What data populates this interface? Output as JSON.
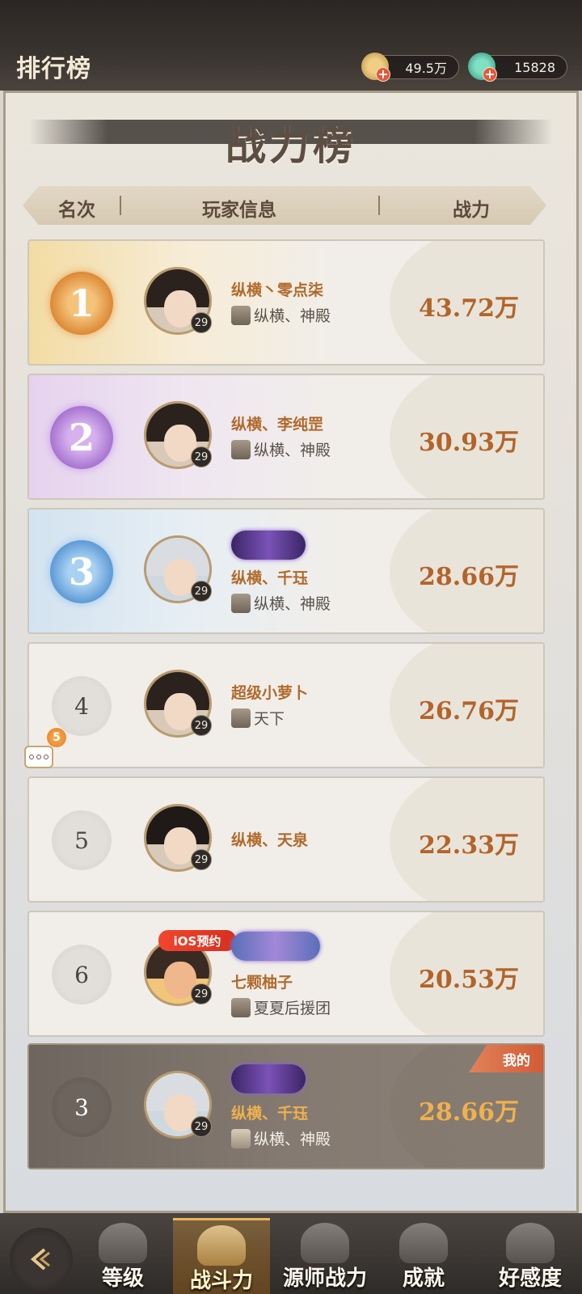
{
  "header": {
    "title": "排行榜",
    "coins": "49.5万",
    "gems": "15828"
  },
  "board": {
    "title": "战力榜",
    "col_rank": "名次",
    "col_player": "玩家信息",
    "col_power": "战力"
  },
  "rows": [
    {
      "rank": "1",
      "name": "纵横丶零点柒",
      "guild": "纵横、神殿",
      "power": "43.72万",
      "level": "29"
    },
    {
      "rank": "2",
      "name": "纵横、李纯罡",
      "guild": "纵横、神殿",
      "power": "30.93万",
      "level": "29"
    },
    {
      "rank": "3",
      "name": "纵横、千珏",
      "guild": "纵横、神殿",
      "power": "28.66万",
      "level": "29"
    },
    {
      "rank": "4",
      "name": "超级小萝卜",
      "guild": "天下",
      "power": "26.76万",
      "level": "29"
    },
    {
      "rank": "5",
      "name": "纵横、天泉",
      "guild": "",
      "power": "22.33万",
      "level": "29"
    },
    {
      "rank": "6",
      "name": "七颗柚子",
      "guild": "夏夏后援团",
      "power": "20.53万",
      "level": "29",
      "tag": "iOS预约"
    }
  ],
  "mine": {
    "label": "我的",
    "rank": "3",
    "name": "纵横、千珏",
    "guild": "纵横、神殿",
    "power": "28.66万",
    "level": "29"
  },
  "chat": {
    "count": "5"
  },
  "nav": {
    "tabs": [
      {
        "label": "等级"
      },
      {
        "label": "战斗力"
      },
      {
        "label": "源师战力"
      },
      {
        "label": "成就"
      },
      {
        "label": "好感度"
      }
    ],
    "active": "战斗力"
  },
  "colors": {
    "accent": "#b3642a",
    "gold": "#e1a048",
    "purple": "#a774d0",
    "blue": "#5e9ad6"
  }
}
